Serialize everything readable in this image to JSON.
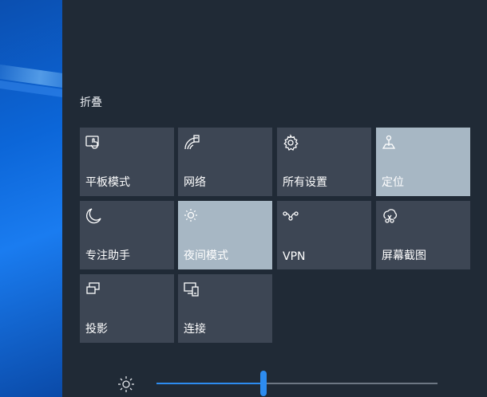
{
  "collapse_label": "折叠",
  "accent_color": "#2d8cf0",
  "tiles": [
    {
      "label": "平板模式",
      "icon": "tablet-mode-icon",
      "active": false
    },
    {
      "label": "网络",
      "icon": "network-icon",
      "active": false
    },
    {
      "label": "所有设置",
      "icon": "gear-icon",
      "active": false
    },
    {
      "label": "定位",
      "icon": "location-icon",
      "active": true
    },
    {
      "label": "专注助手",
      "icon": "moon-icon",
      "active": false
    },
    {
      "label": "夜间模式",
      "icon": "night-light-icon",
      "active": true
    },
    {
      "label": "VPN",
      "icon": "vpn-icon",
      "active": false
    },
    {
      "label": "屏幕截图",
      "icon": "screen-snip-icon",
      "active": false
    },
    {
      "label": "投影",
      "icon": "project-icon",
      "active": false
    },
    {
      "label": "连接",
      "icon": "connect-icon",
      "active": false
    }
  ],
  "brightness": {
    "icon": "brightness-icon",
    "level_percent": 38
  }
}
